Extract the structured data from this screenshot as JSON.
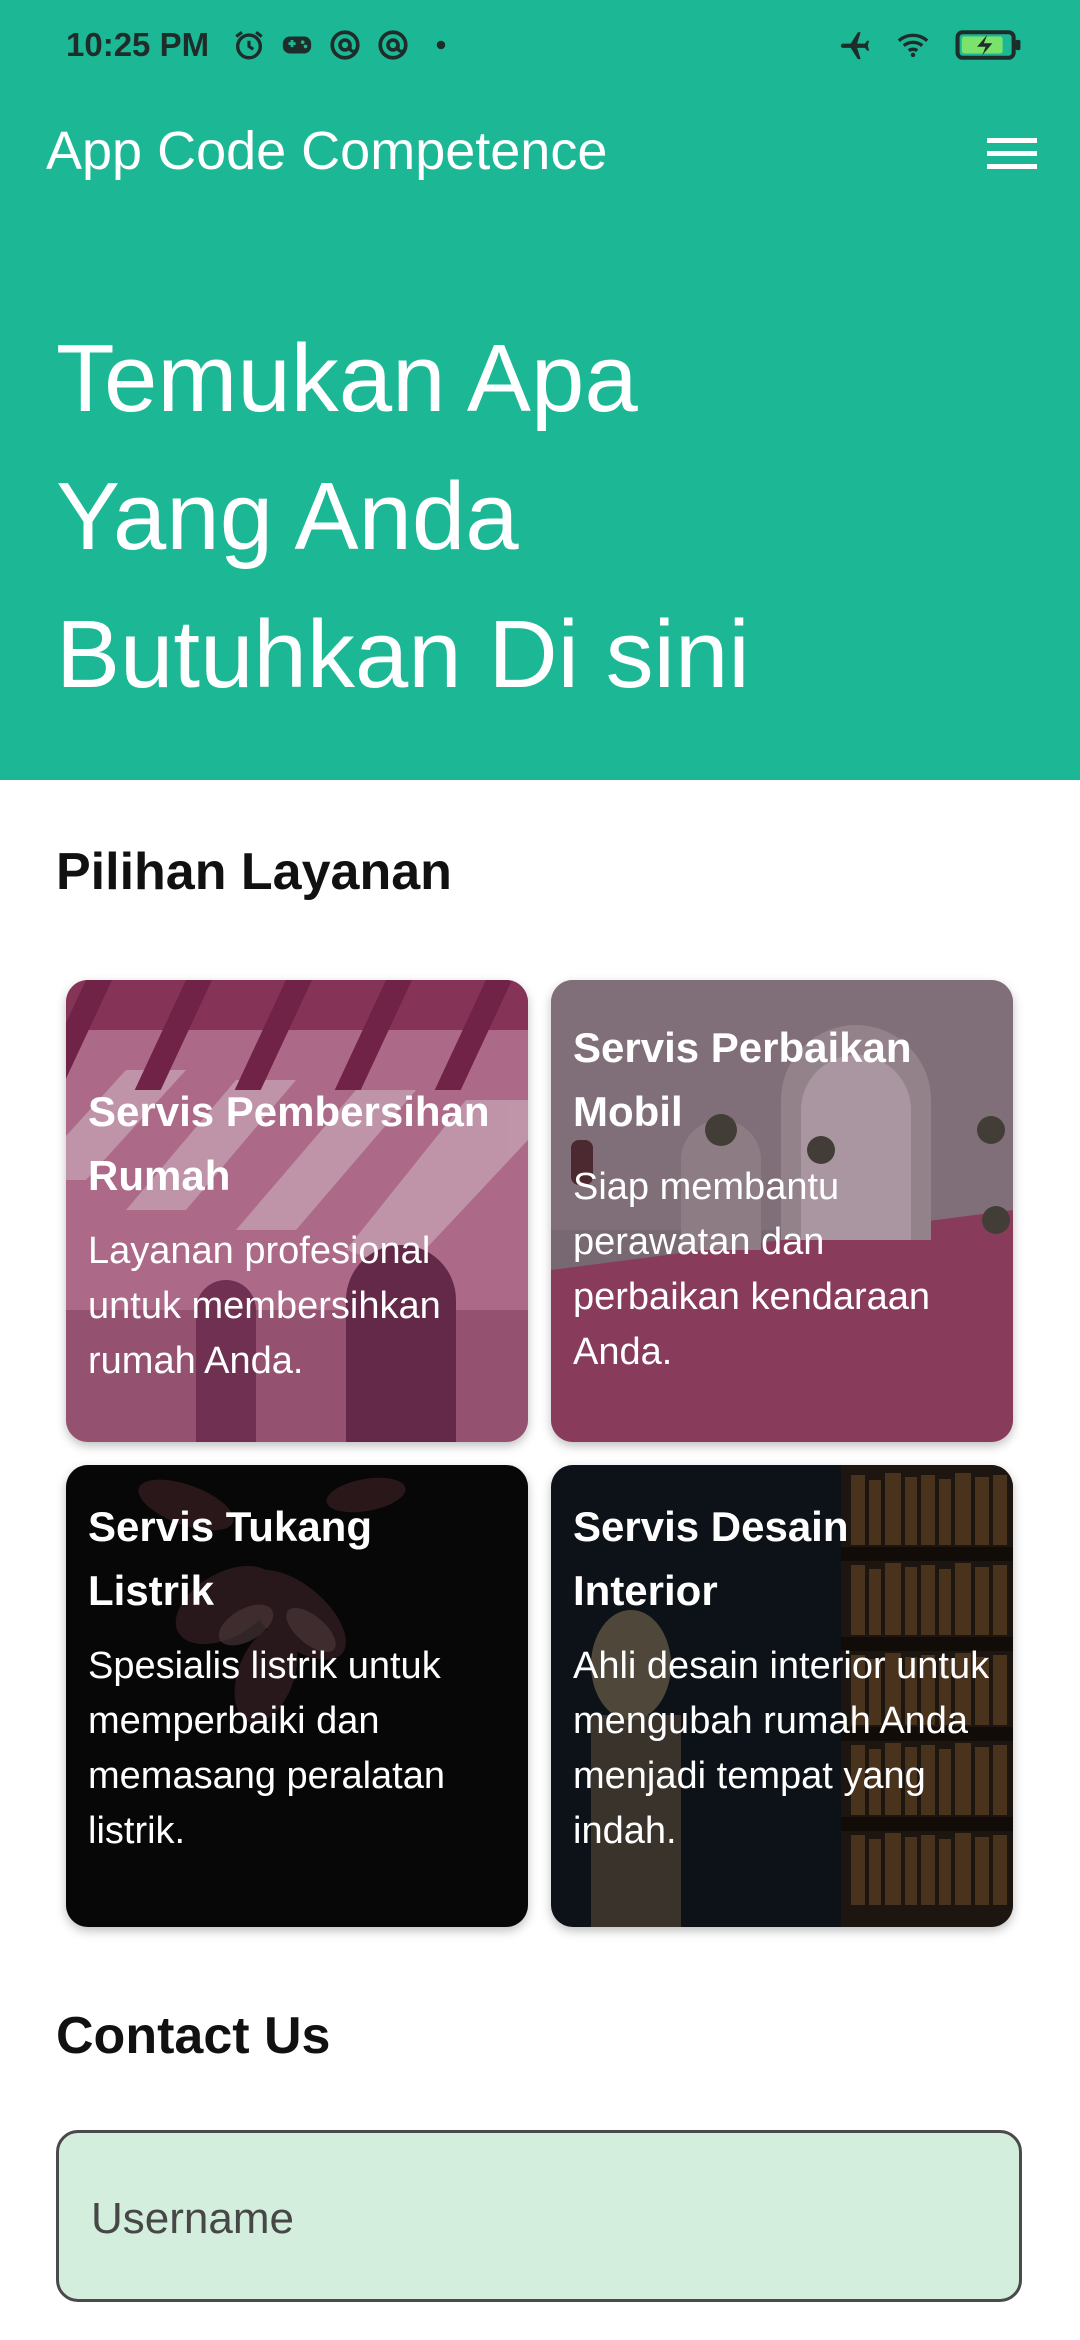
{
  "status_bar": {
    "time": "10:25 PM",
    "left_icons": [
      "alarm-icon",
      "gamepad-icon",
      "at-sign-icon",
      "at-sign-icon",
      "dot-icon"
    ],
    "right_icons": [
      "airplane-icon",
      "wifi-icon",
      "battery-charging-icon"
    ]
  },
  "app_bar": {
    "title": "App Code Competence",
    "menu_icon": "hamburger-menu-icon"
  },
  "hero": {
    "lines": [
      "Temukan Apa",
      "Yang Anda",
      "Butuhkan Di sini"
    ]
  },
  "services": {
    "section_title": "Pilihan Layanan",
    "items": [
      {
        "title": "Servis Pembersihan Rumah",
        "description": "Layanan profesional untuk membersihkan rumah Anda."
      },
      {
        "title": "Servis Perbaikan Mobil",
        "description": "Siap membantu perawatan dan perbaikan kendaraan Anda."
      },
      {
        "title": "Servis Tukang Listrik",
        "description": "Spesialis listrik untuk memperbaiki dan memasang peralatan listrik."
      },
      {
        "title": "Servis Desain Interior",
        "description": "Ahli desain interior untuk mengubah rumah Anda menjadi tempat yang indah."
      }
    ]
  },
  "contact": {
    "section_title": "Contact Us",
    "username_placeholder": "Username"
  },
  "colors": {
    "primary": "#1cb896",
    "input_fill": "#d4eedd"
  }
}
